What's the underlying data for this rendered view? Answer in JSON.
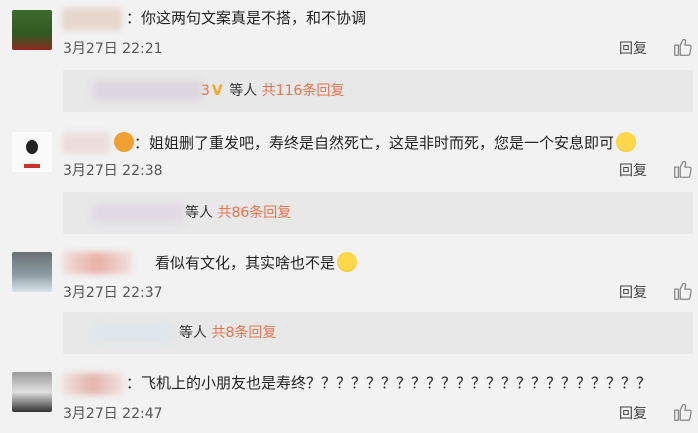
{
  "comments": [
    {
      "text": "：你这两句文案真是不搭，和不协调",
      "time": "3月27日 22:21",
      "reply_label": "回复",
      "sub": {
        "names_tail": "3",
        "vip_mark": "V",
        "mid": " 等人 ",
        "count_label": "共116条回复"
      }
    },
    {
      "text": "：姐姐删了重发吧，寿终是自然死亡，这是非时而死，您是一个安息即可",
      "time": "3月27日 22:38",
      "reply_label": "回复",
      "sub": {
        "mid": "等人 ",
        "count_label": "共86条回复"
      }
    },
    {
      "text": "看似有文化，其实啥也不是",
      "time": "3月27日 22:37",
      "reply_label": "回复",
      "sub": {
        "mid": "等人 ",
        "count_label": "共8条回复"
      }
    },
    {
      "text": "：飞机上的小朋友也是寿终？？？？？？？？？？？？？？？？？？？？？？？",
      "time": "3月27日 22:47",
      "reply_label": "回复"
    }
  ],
  "colors": {
    "accent": "#eb7350",
    "vip": "#f5a623"
  },
  "icons": {
    "like": "thumbs-up-icon"
  }
}
